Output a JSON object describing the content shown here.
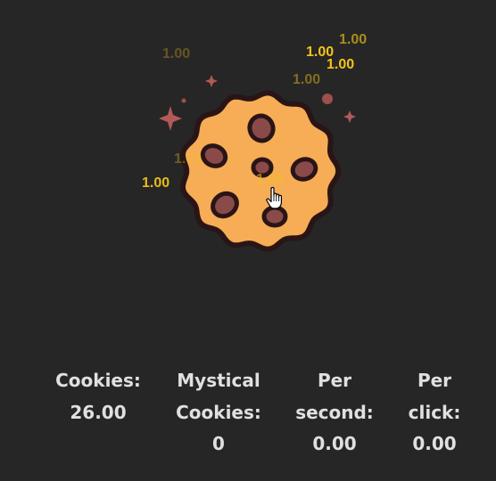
{
  "floating_numbers": [
    {
      "text": "1.00",
      "opacity": 0.3
    },
    {
      "text": "1.00",
      "opacity": 0.65
    },
    {
      "text": "1.00",
      "opacity": 1.0
    },
    {
      "text": "1.00",
      "opacity": 1.0
    },
    {
      "text": "1.00",
      "opacity": 0.45
    },
    {
      "text": "1.00",
      "opacity": 0.35
    },
    {
      "text": "1.00",
      "opacity": 0.95
    },
    {
      "text": "1.00",
      "opacity": 0.6
    }
  ],
  "stats": {
    "cookies": {
      "label_1": "Cookies:",
      "value": "26.00"
    },
    "mystical": {
      "label_1": "Mystical",
      "label_2": "Cookies:",
      "value": "0"
    },
    "per_second": {
      "label_1": "Per",
      "label_2": "second:",
      "value": "0.00"
    },
    "per_click": {
      "label_1": "Per",
      "label_2": "click:",
      "value": "0.00"
    }
  },
  "icons": {
    "cookie": "cookie-icon",
    "sparkle": "sparkle-icon",
    "cursor": "hand-pointer-icon"
  },
  "colors": {
    "background": "#262626",
    "cookie_dough": "#f6ad55",
    "cookie_outline": "#2a1516",
    "chocolate_chip": "#8b4a4a",
    "sparkle": "#b25a58",
    "floating_number": "#f2c31a",
    "stat_text": "#e0e0e0"
  }
}
